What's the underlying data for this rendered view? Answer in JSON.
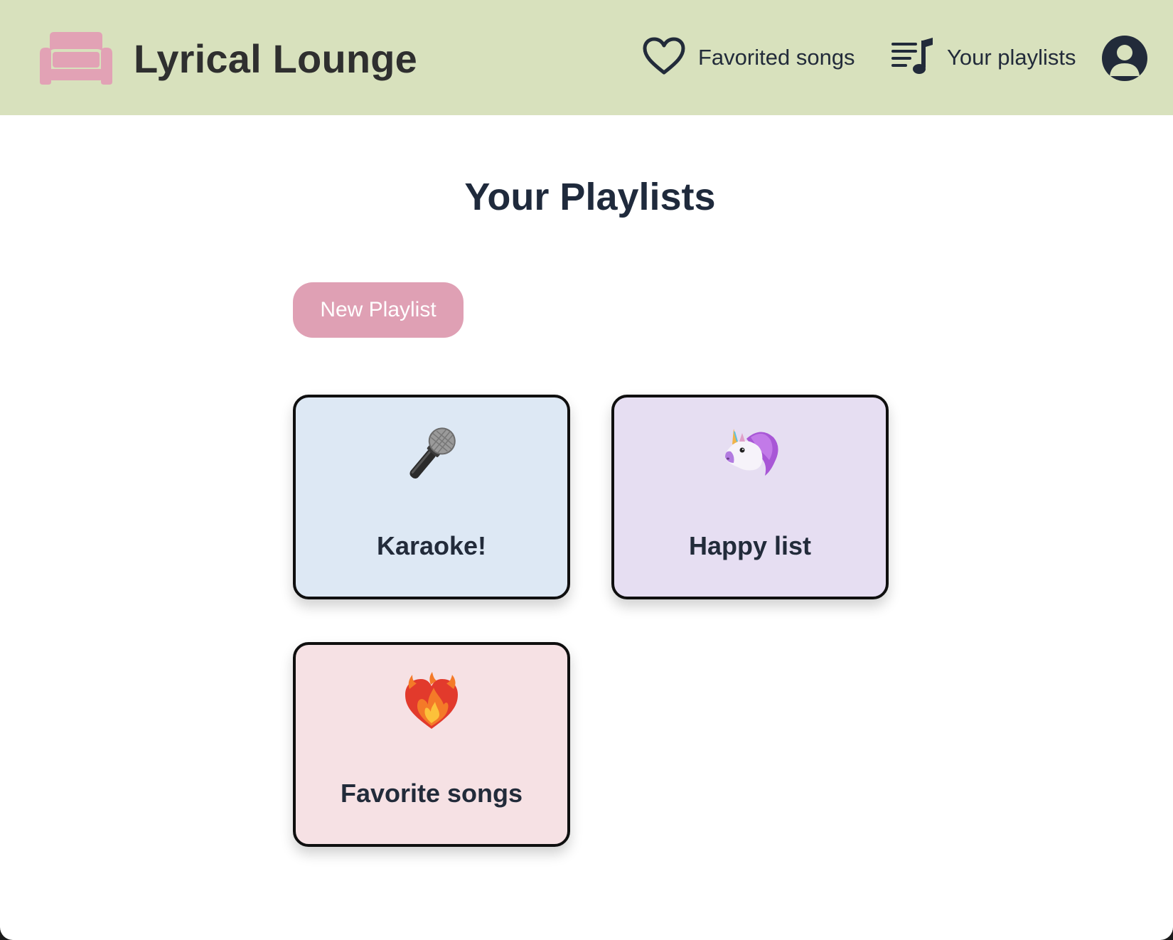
{
  "app": {
    "name": "Lyrical Lounge",
    "brand_icon": "sofa-icon"
  },
  "nav": {
    "favorites": {
      "label": "Favorited songs",
      "icon": "heart-outline-icon"
    },
    "playlists": {
      "label": "Your playlists",
      "icon": "playlist-music-icon"
    },
    "account_icon": "user-avatar-icon"
  },
  "page": {
    "title": "Your Playlists",
    "new_button": "New Playlist"
  },
  "playlists": [
    {
      "name": "Karaoke!",
      "icon": "microphone-icon",
      "color": "#dde8f4"
    },
    {
      "name": "Happy list",
      "icon": "unicorn-icon",
      "color": "#e6def2"
    },
    {
      "name": "Favorite songs",
      "icon": "heart-on-fire-icon",
      "color": "#f6e1e4"
    }
  ],
  "colors": {
    "header_bg": "#d8e1bd",
    "accent_pink": "#dfa0b4",
    "text_dark": "#222b3a"
  }
}
